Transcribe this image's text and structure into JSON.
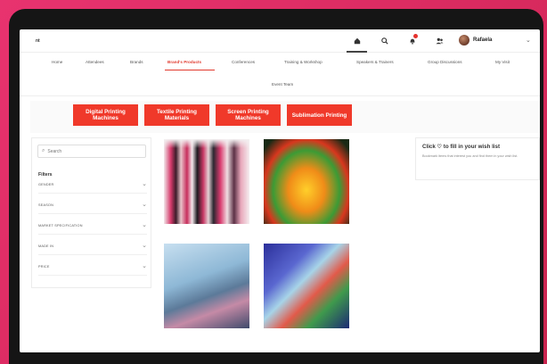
{
  "header": {
    "logo": "nt",
    "icons": [
      "home-icon",
      "search-icon",
      "bell-icon",
      "people-icon"
    ],
    "notification_badge_color": "#e5322d",
    "profile_name": "Rafaela",
    "chevron": "⌄"
  },
  "nav": {
    "items": [
      {
        "label": "Home"
      },
      {
        "label": "Attendees"
      },
      {
        "label": "Brands"
      },
      {
        "label": "Brand's Products",
        "active": true
      },
      {
        "label": "Conferences"
      },
      {
        "label": "Training & Workshop"
      },
      {
        "label": "Speakers & Trainers"
      },
      {
        "label": "Group Discussions"
      },
      {
        "label": "My Visit"
      }
    ],
    "second_row": "Event Team",
    "accent_color": "#e13a2e"
  },
  "categories": [
    {
      "label": "Digital Printing Machines"
    },
    {
      "label": "Textile Printing Materials"
    },
    {
      "label": "Screen Printing Machines"
    },
    {
      "label": "Sublimation Printing"
    }
  ],
  "filters": {
    "search_placeholder": "Search",
    "title": "Filters",
    "items": [
      {
        "label": "GENDER"
      },
      {
        "label": "SEASON"
      },
      {
        "label": "MARKET SPECIFICATION"
      },
      {
        "label": "MADE IN"
      },
      {
        "label": "PRICE"
      }
    ]
  },
  "products": [
    {
      "name": "printed-fabrics"
    },
    {
      "name": "printed-helmet"
    },
    {
      "name": "printed-jacket"
    },
    {
      "name": "printed-mug"
    }
  ],
  "wishlist": {
    "title": "Click ♡ to fill in your wish list",
    "description": "Bookmark items that interest you and find them in your wish list."
  }
}
